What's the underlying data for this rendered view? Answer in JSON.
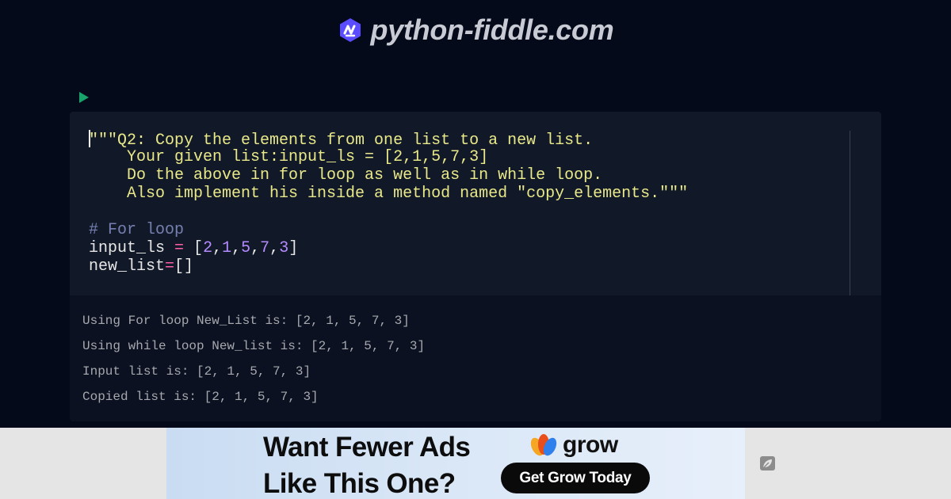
{
  "header": {
    "site_name": "python-fiddle.com",
    "logo_icon": "python-fiddle-logo-icon",
    "accent_color": "#5b4dff"
  },
  "toolbar": {
    "run_icon": "play-icon",
    "run_color": "#18a36b"
  },
  "editor": {
    "lines": [
      [
        {
          "t": "\"\"\"Q2: Copy the elements from one list to a new list.",
          "c": "str"
        }
      ],
      [
        {
          "t": "    Your given list:input_ls = [2,1,5,7,3]",
          "c": "str"
        }
      ],
      [
        {
          "t": "    Do the above in for loop as well as in while loop.",
          "c": "str"
        }
      ],
      [
        {
          "t": "    Also implement his inside a method named \"copy_elements.\"\"\"",
          "c": "str"
        }
      ],
      [
        {
          "t": "",
          "c": "plain"
        }
      ],
      [
        {
          "t": "# For loop",
          "c": "comment"
        }
      ],
      [
        {
          "t": "input_ls ",
          "c": "plain"
        },
        {
          "t": "=",
          "c": "op"
        },
        {
          "t": " [",
          "c": "plain"
        },
        {
          "t": "2",
          "c": "num"
        },
        {
          "t": ",",
          "c": "plain"
        },
        {
          "t": "1",
          "c": "num"
        },
        {
          "t": ",",
          "c": "plain"
        },
        {
          "t": "5",
          "c": "num"
        },
        {
          "t": ",",
          "c": "plain"
        },
        {
          "t": "7",
          "c": "num"
        },
        {
          "t": ",",
          "c": "plain"
        },
        {
          "t": "3",
          "c": "num"
        },
        {
          "t": "]",
          "c": "plain"
        }
      ],
      [
        {
          "t": "new_list",
          "c": "plain"
        },
        {
          "t": "=",
          "c": "op"
        },
        {
          "t": "[]",
          "c": "plain"
        }
      ]
    ]
  },
  "output": {
    "lines": [
      "Using For loop New_List is: [2, 1, 5, 7, 3]",
      "Using while loop New_list is: [2, 1, 5, 7, 3]",
      "Input list is: [2, 1, 5, 7, 3]",
      "Copied list is: [2, 1, 5, 7, 3]"
    ]
  },
  "ad": {
    "headline_line1": "Want Fewer Ads",
    "headline_line2": "Like This One?",
    "brand_name": "grow",
    "cta_label": "Get Grow Today",
    "corner_icon": "leaf-icon"
  }
}
